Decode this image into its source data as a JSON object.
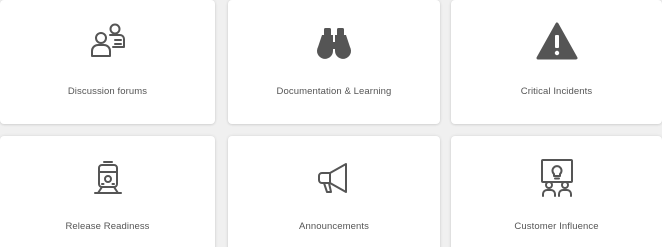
{
  "tiles": [
    {
      "label": "Discussion forums",
      "icon": "discussion-users-icon"
    },
    {
      "label": "Documentation & Learning",
      "icon": "binoculars-icon"
    },
    {
      "label": "Critical Incidents",
      "icon": "warning-icon"
    },
    {
      "label": "Release Readiness",
      "icon": "train-icon"
    },
    {
      "label": "Announcements",
      "icon": "megaphone-icon"
    },
    {
      "label": "Customer Influence",
      "icon": "presentation-lightbulb-icon"
    }
  ],
  "colors": {
    "icon": "#555555",
    "label": "#555555",
    "tile_background": "#ffffff",
    "page_background": "#f0f0f0"
  }
}
